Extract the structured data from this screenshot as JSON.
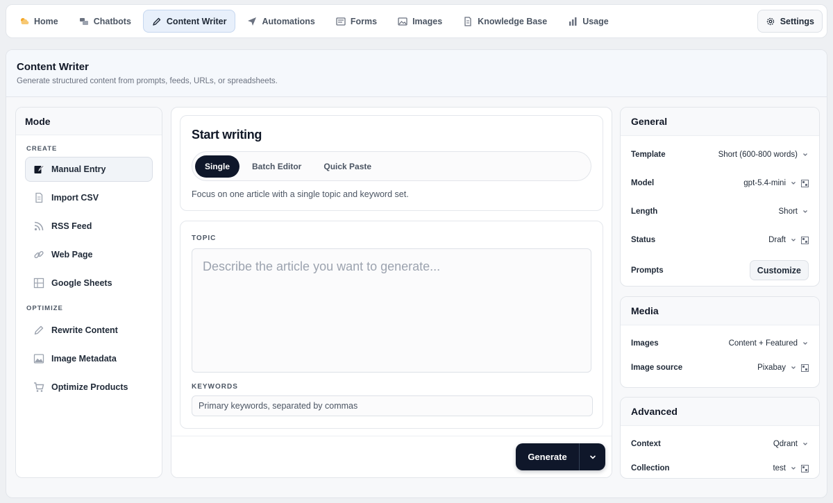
{
  "nav": {
    "items": [
      {
        "label": "Home",
        "icon": "cloud-sun-icon",
        "active": false
      },
      {
        "label": "Chatbots",
        "icon": "chat-bubbles-icon",
        "active": false
      },
      {
        "label": "Content Writer",
        "icon": "pencil-icon",
        "active": true
      },
      {
        "label": "Automations",
        "icon": "plane-icon",
        "active": false
      },
      {
        "label": "Forms",
        "icon": "form-icon",
        "active": false
      },
      {
        "label": "Images",
        "icon": "image-icon",
        "active": false
      },
      {
        "label": "Knowledge Base",
        "icon": "document-icon",
        "active": false
      },
      {
        "label": "Usage",
        "icon": "bar-chart-icon",
        "active": false
      }
    ],
    "settings_label": "Settings"
  },
  "page": {
    "title": "Content Writer",
    "subtitle": "Generate structured content from prompts, feeds, URLs, or spreadsheets."
  },
  "mode": {
    "title": "Mode",
    "create_label": "CREATE",
    "create_items": [
      {
        "label": "Manual Entry",
        "icon": "edit-note-icon",
        "active": true
      },
      {
        "label": "Import CSV",
        "icon": "file-icon",
        "active": false
      },
      {
        "label": "RSS Feed",
        "icon": "rss-icon",
        "active": false
      },
      {
        "label": "Web Page",
        "icon": "link-icon",
        "active": false
      },
      {
        "label": "Google Sheets",
        "icon": "spreadsheet-icon",
        "active": false
      }
    ],
    "optimize_label": "OPTIMIZE",
    "optimize_items": [
      {
        "label": "Rewrite Content",
        "icon": "pencil-icon",
        "active": false
      },
      {
        "label": "Image Metadata",
        "icon": "image-icon",
        "active": false
      },
      {
        "label": "Optimize Products",
        "icon": "cart-icon",
        "active": false
      }
    ]
  },
  "writer": {
    "title": "Start writing",
    "tabs": [
      "Single",
      "Batch Editor",
      "Quick Paste"
    ],
    "active_tab": "Single",
    "description": "Focus on one article with a single topic and keyword set.",
    "topic_label": "TOPIC",
    "topic_placeholder": "Describe the article you want to generate...",
    "topic_value": "",
    "keywords_label": "KEYWORDS",
    "keywords_placeholder": "Primary keywords, separated by commas",
    "keywords_value": "",
    "generate_label": "Generate"
  },
  "general": {
    "title": "General",
    "template_label": "Template",
    "template_value": "Short (600-800 words)",
    "model_label": "Model",
    "model_value": "gpt-5.4-mini",
    "length_label": "Length",
    "length_value": "Short",
    "status_label": "Status",
    "status_value": "Draft",
    "prompts_label": "Prompts",
    "customize_label": "Customize"
  },
  "media": {
    "title": "Media",
    "images_label": "Images",
    "images_value": "Content + Featured",
    "source_label": "Image source",
    "source_value": "Pixabay"
  },
  "advanced": {
    "title": "Advanced",
    "context_label": "Context",
    "context_value": "Qdrant",
    "collection_label": "Collection",
    "collection_value": "test"
  },
  "colors": {
    "accent_dark": "#0f172a",
    "active_nav_bg": "#e8f0fb",
    "page_bg": "#eef0f3"
  }
}
